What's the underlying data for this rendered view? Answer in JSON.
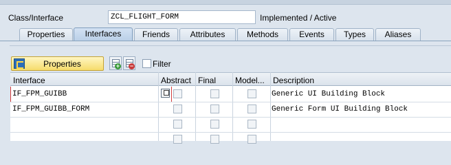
{
  "header": {
    "label": "Class/Interface",
    "value": "ZCL_FLIGHT_FORM",
    "status": "Implemented / Active"
  },
  "tabs": [
    {
      "label": "Properties",
      "active": false
    },
    {
      "label": "Interfaces",
      "active": true
    },
    {
      "label": "Friends",
      "active": false
    },
    {
      "label": "Attributes",
      "active": false
    },
    {
      "label": "Methods",
      "active": false
    },
    {
      "label": "Events",
      "active": false
    },
    {
      "label": "Types",
      "active": false
    },
    {
      "label": "Aliases",
      "active": false
    }
  ],
  "toolbar": {
    "properties_label": "Properties",
    "filter_label": "Filter",
    "filter_checked": false
  },
  "table": {
    "columns": [
      "Interface",
      "Abstract",
      "Final",
      "Model...",
      "Description"
    ],
    "rows": [
      {
        "interface": "IF_FPM_GUIBB",
        "abstract": false,
        "final": false,
        "model": false,
        "description": "Generic UI Building Block"
      },
      {
        "interface": "IF_FPM_GUIBB_FORM",
        "abstract": false,
        "final": false,
        "model": false,
        "description": "Generic Form UI Building Block"
      },
      {
        "interface": "",
        "abstract": false,
        "final": false,
        "model": false,
        "description": ""
      },
      {
        "interface": "",
        "abstract": false,
        "final": false,
        "model": false,
        "description": ""
      }
    ]
  },
  "colors": {
    "background": "#dde5ee",
    "active_tab": "#b9cfe7",
    "properties_button": "#f6dc6c",
    "focus_marker": "#d23a3a"
  }
}
